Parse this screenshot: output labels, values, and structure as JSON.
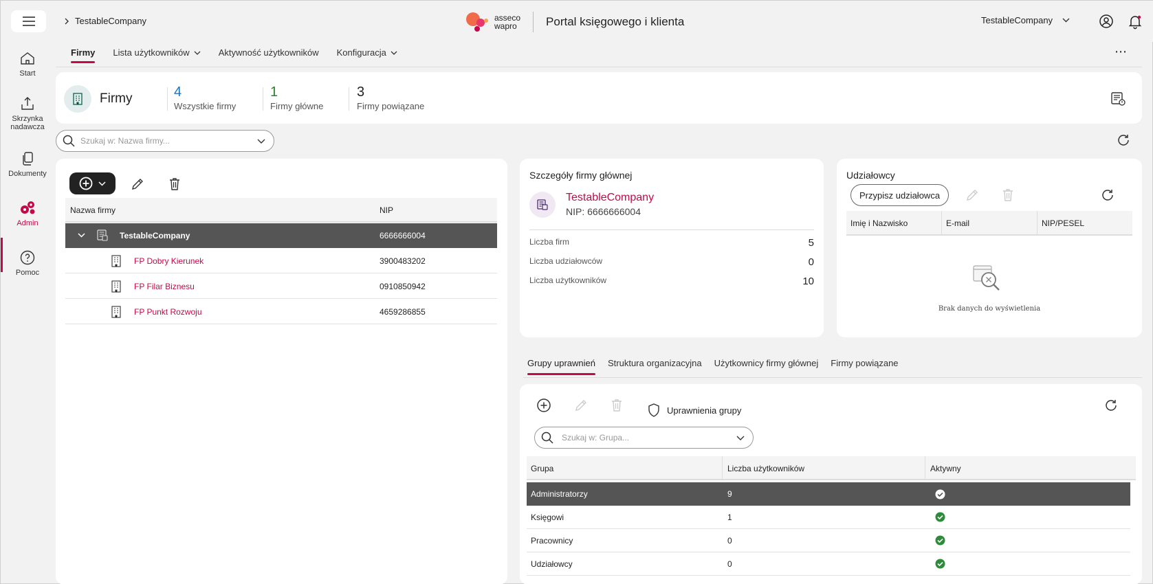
{
  "breadcrumb": {
    "company": "TestableCompany"
  },
  "brand": {
    "logo_line1": "asseco",
    "logo_line2": "wapro",
    "portal_title": "Portal księgowego i klienta"
  },
  "account": {
    "company": "TestableCompany"
  },
  "sidenav": [
    {
      "label": "Start",
      "icon": "home-icon"
    },
    {
      "label": "Skrzynka nadawcza",
      "icon": "outbox-icon"
    },
    {
      "label": "Dokumenty",
      "icon": "documents-icon"
    },
    {
      "label": "Admin",
      "icon": "gears-icon",
      "active": true
    },
    {
      "label": "Pomoc",
      "icon": "help-icon"
    }
  ],
  "tabs": {
    "firmy": "Firmy",
    "users": "Lista użytkowników",
    "activity": "Aktywność użytkowników",
    "config": "Konfiguracja"
  },
  "header": {
    "title": "Firmy",
    "stats": [
      {
        "value": "4",
        "label": "Wszystkie firmy",
        "color": "#1e73be"
      },
      {
        "value": "1",
        "label": "Firmy główne",
        "color": "#2e7d32"
      },
      {
        "value": "3",
        "label": "Firmy powiązane",
        "color": "#222222"
      }
    ]
  },
  "search": {
    "placeholder": "Szukaj w: Nazwa firmy..."
  },
  "companies": {
    "columns": {
      "name": "Nazwa firmy",
      "nip": "NIP"
    },
    "rows": [
      {
        "name": "TestableCompany",
        "nip": "6666666004"
      },
      {
        "name": "FP Dobry Kierunek",
        "nip": "3900483202"
      },
      {
        "name": "FP Filar Biznesu",
        "nip": "0910850942"
      },
      {
        "name": "FP Punkt Rozwoju",
        "nip": "4659286855"
      }
    ]
  },
  "details": {
    "title": "Szczegóły firmy głównej",
    "name": "TestableCompany",
    "nip": "NIP: 6666666004",
    "rows": [
      {
        "label": "Liczba firm",
        "value": "5"
      },
      {
        "label": "Liczba udziałowców",
        "value": "0"
      },
      {
        "label": "Liczba użytkowników",
        "value": "10"
      }
    ]
  },
  "shareholders": {
    "title": "Udziałowcy",
    "assign_label": "Przypisz udziałowca",
    "columns": {
      "name": "Imię i Nazwisko",
      "email": "E-mail",
      "nip": "NIP/PESEL"
    },
    "empty": "Brak danych do wyświetlenia"
  },
  "bottom_tabs": {
    "groups": "Grupy uprawnień",
    "structure": "Struktura organizacyjna",
    "main_users": "Użytkownicy firmy głównej",
    "related": "Firmy powiązane"
  },
  "groups": {
    "permissions_label": "Uprawnienia grupy",
    "search_placeholder": "Szukaj w: Grupa...",
    "columns": {
      "group": "Grupa",
      "users": "Liczba użytkowników",
      "active": "Aktywny"
    },
    "rows": [
      {
        "group": "Administratorzy",
        "users": "9",
        "active": true
      },
      {
        "group": "Księgowi",
        "users": "1",
        "active": true
      },
      {
        "group": "Pracownicy",
        "users": "0",
        "active": true
      },
      {
        "group": "Udziałowcy",
        "users": "0",
        "active": true
      }
    ]
  },
  "colors": {
    "accent": "#c4094b",
    "selected_row": "#555555",
    "check_green": "#2e8b3a"
  }
}
